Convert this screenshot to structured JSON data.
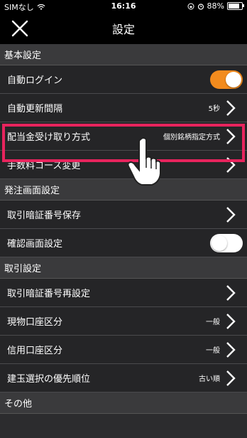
{
  "status": {
    "carrier": "SIMなし",
    "time": "16:16",
    "battery": "88%"
  },
  "nav": {
    "title": "設定"
  },
  "sections": [
    {
      "header": "基本設定",
      "rows": [
        {
          "label": "自動ログイン",
          "control": "toggle-on"
        },
        {
          "label": "自動更新間隔",
          "value": "5秒",
          "control": "chevron"
        },
        {
          "label": "配当金受け取り方式",
          "value": "個別銘柄指定方式",
          "control": "chevron"
        },
        {
          "label": "手数料コース変更",
          "control": "chevron"
        }
      ]
    },
    {
      "header": "発注画面設定",
      "rows": [
        {
          "label": "取引暗証番号保存",
          "control": "chevron"
        },
        {
          "label": "確認画面設定",
          "control": "toggle-off"
        }
      ]
    },
    {
      "header": "取引設定",
      "rows": [
        {
          "label": "取引暗証番号再設定",
          "control": "chevron"
        },
        {
          "label": "現物口座区分",
          "value": "一般",
          "control": "chevron"
        },
        {
          "label": "信用口座区分",
          "value": "一般",
          "control": "chevron"
        },
        {
          "label": "建玉選択の優先順位",
          "value": "古い順",
          "control": "chevron"
        }
      ]
    },
    {
      "header": "その他"
    }
  ],
  "colors": {
    "accent": "#f28b1e",
    "highlight": "#e8245d"
  }
}
